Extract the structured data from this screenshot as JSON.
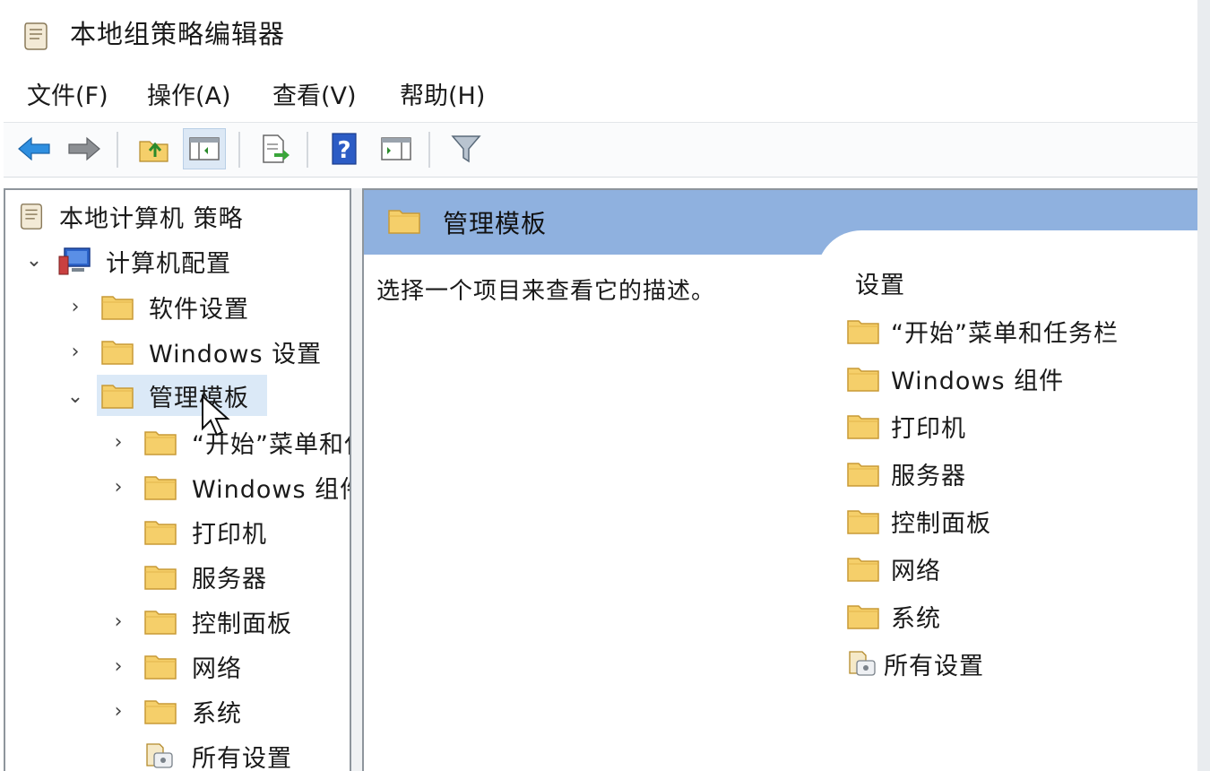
{
  "window": {
    "title": "本地组策略编辑器"
  },
  "menubar": [
    "文件(F)",
    "操作(A)",
    "查看(V)",
    "帮助(H)"
  ],
  "toolbar": {
    "buttons": [
      "back-icon",
      "forward-icon",
      "up-folder-icon",
      "show-hide-tree-icon",
      "export-list-icon",
      "help-icon",
      "show-action-pane-icon",
      "filter-icon"
    ],
    "pressed": "show-hide-tree-icon"
  },
  "tree": {
    "root": "本地计算机 策略",
    "computer_config": "计算机配置",
    "software_settings": "软件设置",
    "windows_settings": "Windows 设置",
    "admin_templates": "管理模板",
    "children": [
      "“开始”菜单和任务栏",
      "Windows 组件",
      "打印机",
      "服务器",
      "控制面板",
      "网络",
      "系统",
      "所有设置"
    ]
  },
  "content": {
    "header_title": "管理模板",
    "description": "选择一个项目来查看它的描述。",
    "settings_heading": "设置",
    "items": [
      "“开始”菜单和任务栏",
      "Windows 组件",
      "打印机",
      "服务器",
      "控制面板",
      "网络",
      "系统",
      "所有设置"
    ]
  },
  "colors": {
    "header_blue": "#8fb1df",
    "folder": "#f5cf6a",
    "selection": "#dbe9f7"
  }
}
